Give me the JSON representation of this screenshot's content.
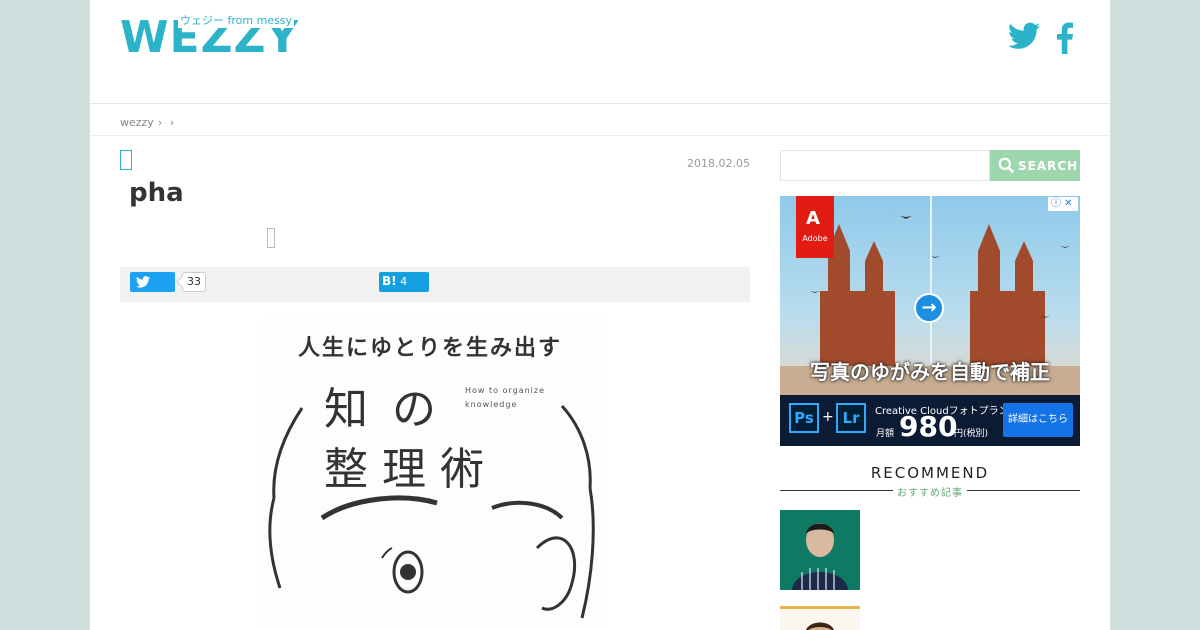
{
  "header": {
    "logo_text": "WEZZY",
    "logo_subtitle": "ウェジー from messy"
  },
  "breadcrumb": {
    "home": "wezzy",
    "sep1": "›",
    "sep2": "›"
  },
  "article": {
    "date": "2018.02.05",
    "title": "pha",
    "share": {
      "tweet_count": "33",
      "hatena_label": "B!",
      "hatena_count": "4"
    },
    "cover": {
      "line1": "人生にゆとりを生み出す",
      "line2": "知の",
      "line3": "整理術",
      "english": "How to organize knowledge"
    }
  },
  "sidebar": {
    "search_button": "SEARCH",
    "ad": {
      "brand": "Adobe",
      "caption": "写真のゆがみを自動で補正",
      "plan": "Creative Cloudフォトプラン",
      "price_label": "月額",
      "price": "980",
      "price_unit": "円(税別)",
      "cta": "詳細はこちら",
      "ps": "Ps",
      "lr": "Lr"
    },
    "recommend_title": "RECOMMEND",
    "recommend_subtitle": "おすすめ記事"
  },
  "colors": {
    "brand": "#2bb4c9",
    "search_button": "#9ed6ae",
    "twitter": "#1da1f2",
    "hatena": "#14a0e0",
    "background": "#cfe0df"
  }
}
